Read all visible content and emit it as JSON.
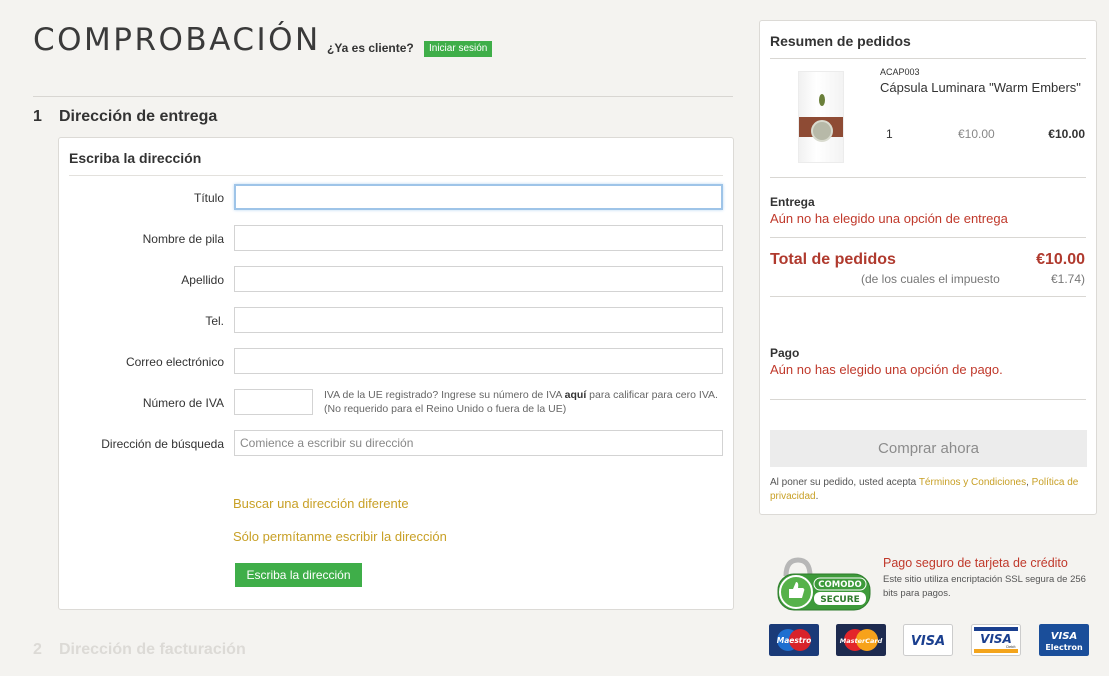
{
  "header": {
    "title": "COMPROBACIÓN",
    "returning": "¿Ya es cliente?",
    "login_label": "Iniciar sesión"
  },
  "steps": [
    {
      "num": "1",
      "label": "Dirección de entrega"
    },
    {
      "num": "2",
      "label": "Dirección de facturación"
    }
  ],
  "address_form": {
    "heading": "Escriba la dirección",
    "fields": {
      "title": {
        "label": "Título",
        "value": ""
      },
      "first_name": {
        "label": "Nombre de pila",
        "value": ""
      },
      "last_name": {
        "label": "Apellido",
        "value": ""
      },
      "phone": {
        "label": "Tel.",
        "value": ""
      },
      "email": {
        "label": "Correo electrónico",
        "value": ""
      },
      "vat": {
        "label": "Número de IVA",
        "value": ""
      },
      "lookup": {
        "label": "Dirección de búsqueda",
        "value": "",
        "placeholder": "Comience a escribir su dirección"
      }
    },
    "vat_note_pre": "IVA de la UE registrado? Ingrese su número de IVA ",
    "vat_note_bold": "aquí",
    "vat_note_post": " para calificar para cero IVA. (No requerido para el Reino Unido o fuera de la UE)",
    "links": {
      "different": "Buscar una dirección diferente",
      "manual": "Sólo permítanme escribir la dirección"
    },
    "submit_label": "Escriba la dirección"
  },
  "summary": {
    "heading": "Resumen de pedidos",
    "item": {
      "sku": "ACAP003",
      "name": "Cápsula Luminara \"Warm Embers\"",
      "qty": "1",
      "unit_price": "€10.00",
      "line_total": "€10.00"
    },
    "delivery_label": "Entrega",
    "delivery_warning": "Aún no ha elegido una opción de entrega",
    "total_label": "Total de pedidos",
    "total_value": "€10.00",
    "tax_label": "(de los cuales el impuesto",
    "tax_value": "€1.74)",
    "payment_label": "Pago",
    "payment_warning": "Aún no has elegido una opción de pago.",
    "buy_label": "Comprar ahora",
    "terms_pre": "Al poner su pedido, usted acepta ",
    "terms_link": "Términos y Condiciones",
    "terms_mid": ", ",
    "privacy_link": "Política de privacidad",
    "terms_post": "."
  },
  "security": {
    "badge_top": "COMODO",
    "badge_bottom": "SECURE",
    "title": "Pago seguro de tarjeta de crédito",
    "text": "Este sitio utiliza encriptación SSL segura de 256 bits para pagos."
  },
  "cards": {
    "maestro": "Maestro",
    "mastercard": "MasterCard",
    "visa": "VISA",
    "visa_debit": "VISA",
    "visa_debit_sub": "Debit",
    "visa_electron": "VISA",
    "visa_electron_sub": "Electron"
  },
  "colors": {
    "accent_green": "#3fae49",
    "warning_red": "#c0392b",
    "link_gold": "#c8a026"
  }
}
